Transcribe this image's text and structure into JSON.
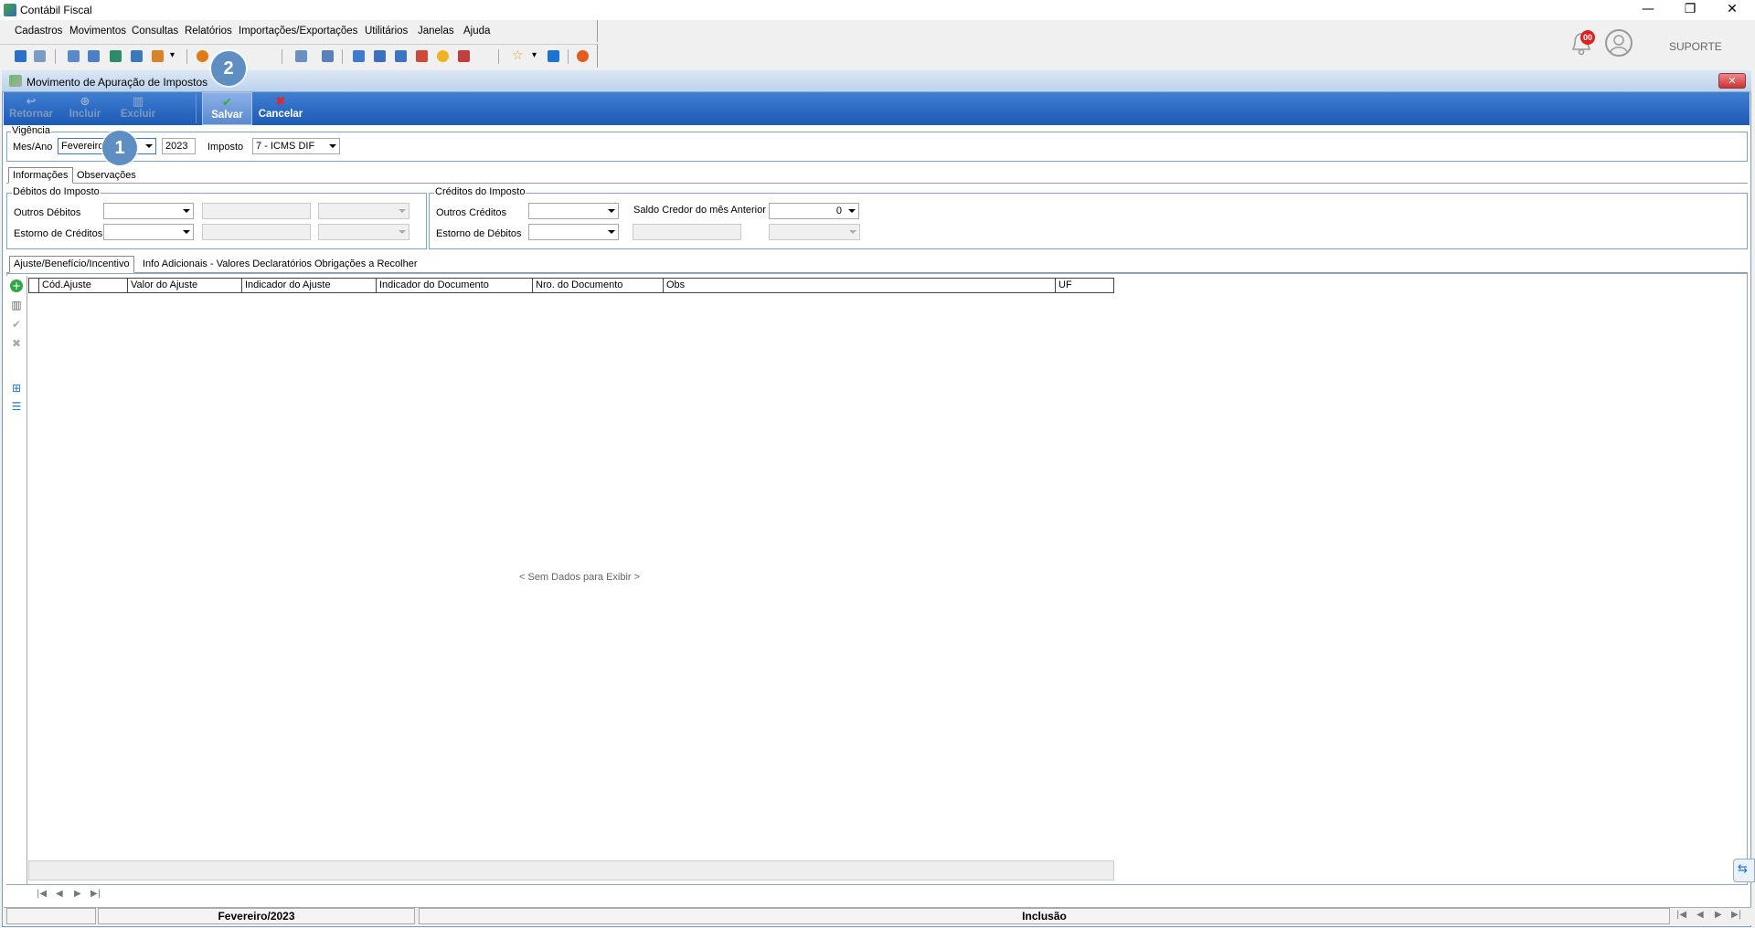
{
  "window": {
    "title": "Contábil Fiscal",
    "controls": {
      "minimize": "—",
      "restore": "❐",
      "close": "✕"
    }
  },
  "menu": [
    "Cadastros",
    "Movimentos",
    "Consultas",
    "Relatórios",
    "Importações/Exportações",
    "Utilitários",
    "Janelas",
    "Ajuda"
  ],
  "header": {
    "notification_count": "00",
    "user_label": "SUPORTE"
  },
  "inner_window": {
    "title": "Movimento de Apuração de Impostos",
    "close": "✕"
  },
  "ribbon": {
    "retornar": "Retornar",
    "incluir": "Incluir",
    "excluir": "Excluir",
    "salvar": "Salvar",
    "cancelar": "Cancelar"
  },
  "vigencia": {
    "group_label": "Vigência",
    "mes_ano_label": "Mes/Ano",
    "month_value": "Fevereiro",
    "year_value": "2023",
    "imposto_label": "Imposto",
    "imposto_value": "7 - ICMS DIF"
  },
  "tabs": {
    "info": "Informações",
    "obs": "Observações"
  },
  "debitos": {
    "group_label": "Débitos do Imposto",
    "outros_debitos": "Outros Débitos",
    "estorno_creditos": "Estorno de Créditos"
  },
  "creditos": {
    "group_label": "Créditos do Imposto",
    "outros_creditos": "Outros Créditos",
    "estorno_debitos": "Estorno de Débitos",
    "saldo_label": "Saldo Credor do mês Anterior",
    "saldo_value": "0"
  },
  "subtabs": {
    "ajuste": "Ajuste/Benefício/Incentivo",
    "info_adicionais": "Info Adicionais - Valores Declaratórios",
    "obrigacoes": "Obrigações a Recolher"
  },
  "grid": {
    "columns": [
      "Cód.Ajuste",
      "Valor do Ajuste",
      "Indicador do Ajuste",
      "Indicador do Documento",
      "Nro. do Documento",
      "Obs",
      "UF"
    ],
    "empty_text": "< Sem Dados para Exibir >"
  },
  "nav": {
    "first": "|◀",
    "prev": "◀",
    "next": "▶",
    "last": "▶|"
  },
  "status": {
    "period": "Fevereiro/2023",
    "mode": "Inclusão"
  },
  "callouts": {
    "one": "1",
    "two": "2"
  },
  "colors": {
    "ribbon": "#1d5bb5",
    "accent_blue": "#3f7fd1",
    "save_check": "#31b531",
    "cancel_x": "#ee2222"
  }
}
